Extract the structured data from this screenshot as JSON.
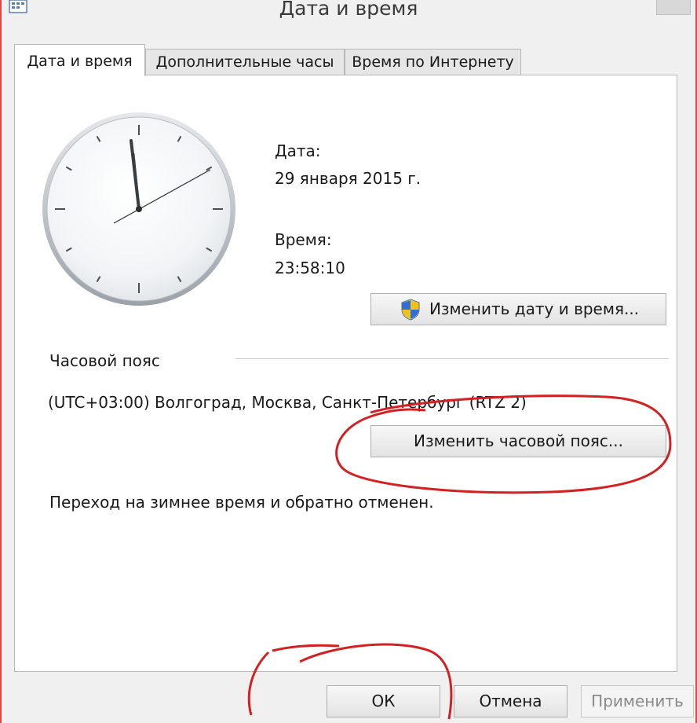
{
  "window": {
    "title": "Дата и время"
  },
  "tabs": [
    {
      "label": "Дата и время",
      "active": true
    },
    {
      "label": "Дополнительные часы",
      "active": false
    },
    {
      "label": "Время по Интернету",
      "active": false
    }
  ],
  "datetime": {
    "date_label": "Дата:",
    "date_value": "29 января 2015 г.",
    "time_label": "Время:",
    "time_value": "23:58:10",
    "change_button": "Изменить дату и время..."
  },
  "timezone": {
    "section_label": "Часовой пояс",
    "value": "(UTC+03:00) Волгоград, Москва, Санкт-Петербург (RTZ 2)",
    "change_button": "Изменить часовой пояс...",
    "dst_note": "Переход на зимнее время и обратно отменен."
  },
  "footer": {
    "ok": "ОК",
    "cancel": "Отмена",
    "apply": "Применить"
  },
  "colors": {
    "annotation": "#d42020",
    "window_border": "#d94b4b"
  },
  "icons": [
    "app-icon",
    "uac-shield-icon",
    "analog-clock"
  ]
}
